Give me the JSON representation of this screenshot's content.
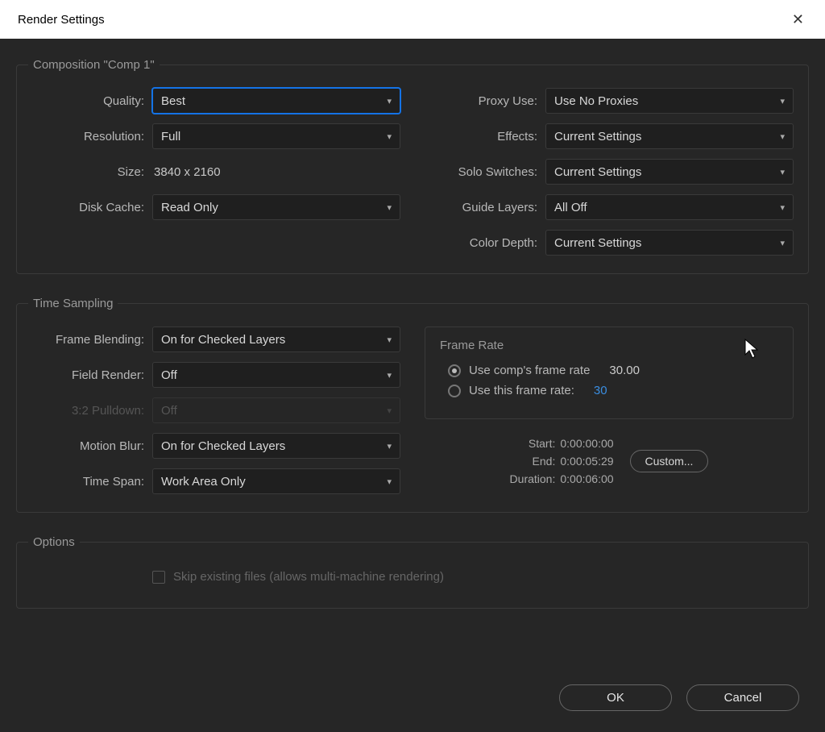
{
  "title": "Render Settings",
  "composition": {
    "legend": "Composition \"Comp 1\"",
    "left": {
      "quality_label": "Quality:",
      "quality_value": "Best",
      "resolution_label": "Resolution:",
      "resolution_value": "Full",
      "size_label": "Size:",
      "size_value": "3840 x 2160",
      "disk_cache_label": "Disk Cache:",
      "disk_cache_value": "Read Only"
    },
    "right": {
      "proxy_label": "Proxy Use:",
      "proxy_value": "Use No Proxies",
      "effects_label": "Effects:",
      "effects_value": "Current Settings",
      "solo_label": "Solo Switches:",
      "solo_value": "Current Settings",
      "guide_label": "Guide Layers:",
      "guide_value": "All Off",
      "depth_label": "Color Depth:",
      "depth_value": "Current Settings"
    }
  },
  "time_sampling": {
    "legend": "Time Sampling",
    "frame_blending_label": "Frame Blending:",
    "frame_blending_value": "On for Checked Layers",
    "field_render_label": "Field Render:",
    "field_render_value": "Off",
    "pulldown_label": "3:2 Pulldown:",
    "pulldown_value": "Off",
    "motion_blur_label": "Motion Blur:",
    "motion_blur_value": "On for Checked Layers",
    "time_span_label": "Time Span:",
    "time_span_value": "Work Area Only",
    "frame_rate": {
      "title": "Frame Rate",
      "use_comp_label": "Use comp's frame rate",
      "use_comp_value": "30.00",
      "use_this_label": "Use this frame rate:",
      "use_this_value": "30"
    },
    "times": {
      "start_label": "Start:",
      "start_value": "0:00:00:00",
      "end_label": "End:",
      "end_value": "0:00:05:29",
      "duration_label": "Duration:",
      "duration_value": "0:00:06:00",
      "custom_label": "Custom..."
    }
  },
  "options": {
    "legend": "Options",
    "skip_label": "Skip existing files (allows multi-machine rendering)"
  },
  "footer": {
    "ok": "OK",
    "cancel": "Cancel"
  }
}
